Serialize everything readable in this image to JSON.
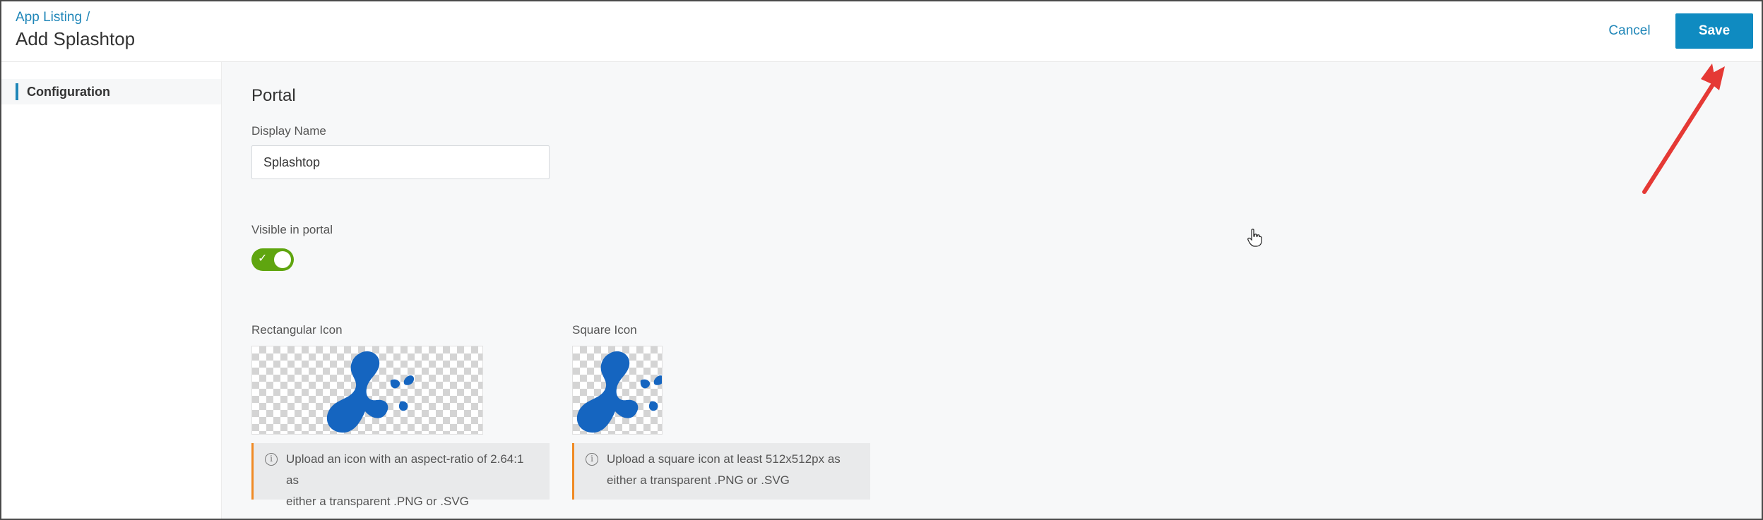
{
  "header": {
    "breadcrumb_link": "App Listing",
    "breadcrumb_sep": "/",
    "title": "Add Splashtop",
    "cancel_label": "Cancel",
    "save_label": "Save"
  },
  "sidebar": {
    "items": [
      {
        "label": "Configuration",
        "active": true
      }
    ]
  },
  "portal": {
    "section_title": "Portal",
    "display_name_label": "Display Name",
    "display_name_value": "Splashtop",
    "visible_label": "Visible in portal",
    "visible_on": true,
    "rect_icon_label": "Rectangular Icon",
    "square_icon_label": "Square Icon",
    "rect_info_line1": "Upload an icon with an aspect-ratio of 2.64:1 as",
    "rect_info_line2": "either a transparent .PNG or .SVG",
    "square_info_line1": "Upload a square icon at least 512x512px as",
    "square_info_line2": "either a transparent .PNG or .SVG"
  },
  "colors": {
    "accent": "#0f8bc1",
    "link": "#1f86b8",
    "toggle_on": "#5fa50f",
    "warning_border": "#f08a24",
    "logo_blue": "#1565c0",
    "annotation_arrow": "#e53935"
  },
  "icons": {
    "info": "info-icon",
    "check": "check-icon",
    "logo": "splashtop-logo",
    "cursor": "hand-cursor-icon",
    "annotation": "red-arrow-annotation"
  }
}
